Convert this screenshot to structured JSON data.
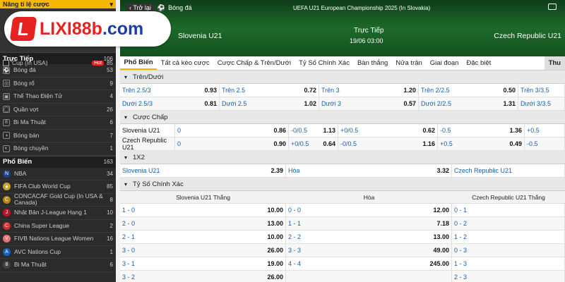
{
  "sidebar": {
    "top": {
      "label": "Nâng tỉ lệ cược",
      "chevron": "▾"
    },
    "logo": {
      "mark": "L",
      "text_a": "LIXI",
      "text_b": "88b",
      "text_c": ".com"
    },
    "promo": {
      "label": "Cup (In USA)",
      "hot": "Hot",
      "count": "85"
    },
    "live_section": {
      "title": "Trực Tiếp",
      "count": "106"
    },
    "live_items": [
      {
        "icon": "soccer-icon",
        "glyph": "⚽",
        "label": "Bóng đá",
        "count": "53"
      },
      {
        "icon": "basketball-icon",
        "glyph": "◎",
        "label": "Bóng rổ",
        "count": "9"
      },
      {
        "icon": "gamepad-icon",
        "glyph": "▣",
        "label": "Thể Thao Điện Tử",
        "count": "4"
      },
      {
        "icon": "tennis-icon",
        "glyph": "◯",
        "label": "Quần vợt",
        "count": "26"
      },
      {
        "icon": "billiards-icon",
        "glyph": "8",
        "label": "Bi Ma Thuật",
        "count": "6"
      },
      {
        "icon": "pingpong-icon",
        "glyph": "◑",
        "label": "Bóng bàn",
        "count": "7"
      },
      {
        "icon": "volleyball-icon",
        "glyph": "◐",
        "label": "Bóng chuyền",
        "count": "1"
      }
    ],
    "popular_section": {
      "title": "Phổ Biến",
      "count": "163"
    },
    "popular_items": [
      {
        "icon": "nba-icon",
        "color": "#1d428a",
        "glyph": "N",
        "label": "NBA",
        "count": "34"
      },
      {
        "icon": "fifa-club-icon",
        "color": "#c9a227",
        "glyph": "★",
        "label": "FIFA Club World Cup",
        "count": "85"
      },
      {
        "icon": "concacaf-icon",
        "color": "#b8860b",
        "glyph": "C",
        "label": "CONCACAF Gold Cup (In USA & Canada)",
        "count": "8"
      },
      {
        "icon": "jleague-icon",
        "color": "#c8102e",
        "glyph": "J",
        "label": "Nhật Bản J-League Hạng 1",
        "count": "10"
      },
      {
        "icon": "china-league-icon",
        "color": "#d32f2f",
        "glyph": "C",
        "label": "China Super League",
        "count": "2"
      },
      {
        "icon": "fivb-icon",
        "color": "#e57373",
        "glyph": "V",
        "label": "FIVB Nations League Women",
        "count": "16"
      },
      {
        "icon": "avc-icon",
        "color": "#1565c0",
        "glyph": "A",
        "label": "AVC Nations Cup",
        "count": "1"
      },
      {
        "icon": "billiards-icon",
        "color": "#444",
        "glyph": "8",
        "label": "Bi Ma Thuật",
        "count": "6"
      }
    ]
  },
  "hero": {
    "back_label": "Trở lại",
    "sport_label": "Bóng đá",
    "league": "UEFA U21 European Championship 2025 (In Slovakia)",
    "home_team": "Slovenia U21",
    "away_team": "Czech Republic U21",
    "status": "Trực Tiếp",
    "datetime": "19/06 03:00"
  },
  "tabs": [
    "Phổ Biến",
    "Tất cả kèo cược",
    "Cược Chấp & Trên/Dưới",
    "Tỷ Số Chính Xác",
    "Bàn thắng",
    "Nửa trận",
    "Giai đoạn",
    "Đặc biệt"
  ],
  "tab_end": "Thu",
  "over_under": {
    "title": "Trên/Dưới",
    "rows": [
      [
        [
          "Trên 2.5/3",
          "0.93"
        ],
        [
          "Trên 2.5",
          "0.72"
        ],
        [
          "Trên 3",
          "1.20"
        ],
        [
          "Trên 2/2.5",
          "0.50"
        ],
        [
          "Trên 3/3.5",
          ""
        ]
      ],
      [
        [
          "Dưới 2.5/3",
          "0.81"
        ],
        [
          "Dưới 2.5",
          "1.02"
        ],
        [
          "Dưới 3",
          "0.57"
        ],
        [
          "Dưới 2/2.5",
          "1.31"
        ],
        [
          "Dưới 3/3.5",
          ""
        ]
      ]
    ]
  },
  "handicap": {
    "title": "Cược Chấp",
    "rows": [
      {
        "team": "Slovenia U21",
        "cells": [
          [
            "0",
            "0.86"
          ],
          [
            "-0/0.5",
            "1.13"
          ],
          [
            "+0/0.5",
            "0.62"
          ],
          [
            "-0.5",
            "1.36"
          ],
          [
            "+0.5",
            ""
          ]
        ]
      },
      {
        "team": "Czech Republic U21",
        "cells": [
          [
            "0",
            "0.90"
          ],
          [
            "+0/0.5",
            "0.64"
          ],
          [
            "-0/0.5",
            "1.16"
          ],
          [
            "+0.5",
            "0.49"
          ],
          [
            "-0.5",
            ""
          ]
        ]
      }
    ]
  },
  "one_x_two": {
    "title": "1X2",
    "cells": [
      [
        "Slovenia U21",
        "2.39"
      ],
      [
        "Hòa",
        "3.32"
      ],
      [
        "Czech Republic U21",
        ""
      ]
    ]
  },
  "correct_score": {
    "title": "Tỷ Số Chính Xác",
    "headers": [
      "Slovenia U21 Thắng",
      "Hòa",
      "Czech Republic U21 Thắng"
    ],
    "rows": [
      [
        [
          "1 - 0",
          "10.00"
        ],
        [
          "0 - 0",
          "12.00"
        ],
        [
          "0 - 1",
          ""
        ]
      ],
      [
        [
          "2 - 0",
          "13.00"
        ],
        [
          "1 - 1",
          "7.18"
        ],
        [
          "0 - 2",
          ""
        ]
      ],
      [
        [
          "2 - 1",
          "10.00"
        ],
        [
          "2 - 2",
          "13.00"
        ],
        [
          "1 - 2",
          ""
        ]
      ],
      [
        [
          "3 - 0",
          "26.00"
        ],
        [
          "3 - 3",
          "49.00"
        ],
        [
          "0 - 3",
          ""
        ]
      ],
      [
        [
          "3 - 1",
          "19.00"
        ],
        [
          "4 - 4",
          "245.00"
        ],
        [
          "1 - 3",
          ""
        ]
      ],
      [
        [
          "3 - 2",
          "26.00"
        ],
        [
          "",
          ""
        ],
        [
          "2 - 3",
          ""
        ]
      ]
    ]
  },
  "colors": {
    "accent": "#f5b800",
    "link": "#1a5fa8",
    "brand_red": "#e52421",
    "brand_blue": "#1a3fa8"
  }
}
